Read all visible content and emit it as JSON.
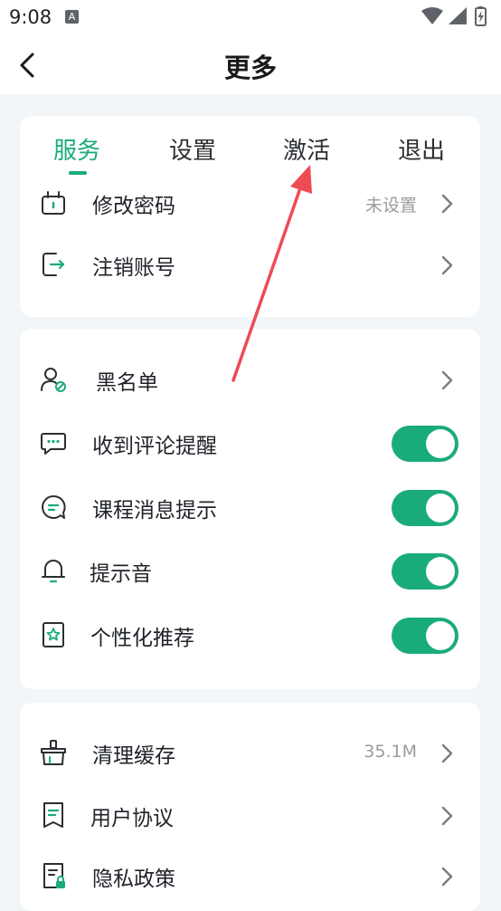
{
  "status_bar": {
    "time": "9:08",
    "notification_letter": "A"
  },
  "header": {
    "title": "更多"
  },
  "tabs": [
    {
      "label": "服务"
    },
    {
      "label": "设置"
    },
    {
      "label": "激活"
    },
    {
      "label": "退出"
    }
  ],
  "section1": {
    "items": [
      {
        "label": "修改密码",
        "value": "未设置"
      },
      {
        "label": "注销账号"
      }
    ]
  },
  "section2": {
    "items": [
      {
        "label": "黑名单"
      },
      {
        "label": "收到评论提醒",
        "enabled": true
      },
      {
        "label": "课程消息提示",
        "enabled": true
      },
      {
        "label": "提示音",
        "enabled": true
      },
      {
        "label": "个性化推荐",
        "enabled": true
      }
    ]
  },
  "section3": {
    "items": [
      {
        "label": "清理缓存",
        "value": "35.1M"
      },
      {
        "label": "用户协议"
      },
      {
        "label": "隐私政策"
      }
    ]
  },
  "colors": {
    "accent": "#1aab7a",
    "annotation_arrow": "#ee4b55"
  }
}
